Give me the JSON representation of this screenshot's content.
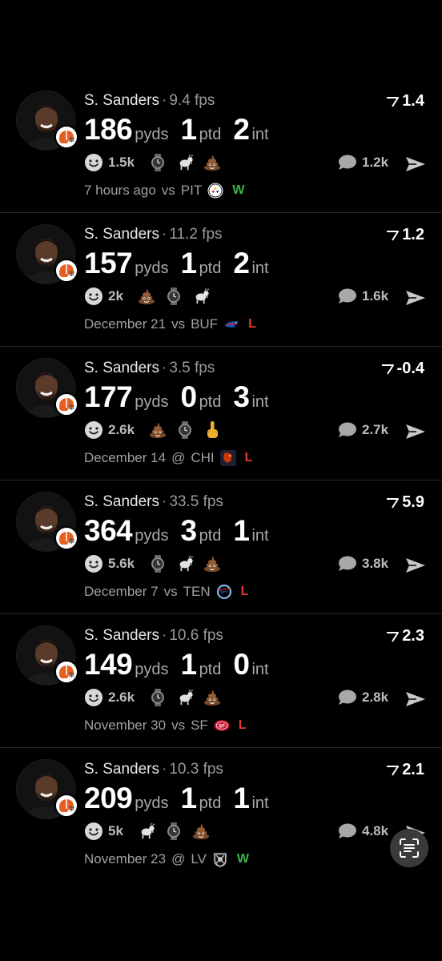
{
  "posts": [
    {
      "name": "S. Sanders",
      "fps": "9.4 fps",
      "vote": "1.4",
      "pyds": "186",
      "pyds_unit": "pyds",
      "ptd": "1",
      "ptd_unit": "ptd",
      "int": "2",
      "int_unit": "int",
      "reaction_count": "1.5k",
      "reactions": [
        "clock-icon",
        "goat-emoji-icon",
        "poop-emoji-icon"
      ],
      "comments": "1.2k",
      "time": "7 hours ago",
      "location": "vs",
      "opponent": "PIT",
      "opponent_logo": "steelers-logo",
      "result": "W"
    },
    {
      "name": "S. Sanders",
      "fps": "11.2 fps",
      "vote": "1.2",
      "pyds": "157",
      "pyds_unit": "pyds",
      "ptd": "1",
      "ptd_unit": "ptd",
      "int": "2",
      "int_unit": "int",
      "reaction_count": "2k",
      "reactions": [
        "poop-emoji-icon",
        "clock-icon",
        "goat-emoji-icon"
      ],
      "comments": "1.6k",
      "time": "December 21",
      "location": "vs",
      "opponent": "BUF",
      "opponent_logo": "bills-logo",
      "result": "L"
    },
    {
      "name": "S. Sanders",
      "fps": "3.5 fps",
      "vote": "-0.4",
      "pyds": "177",
      "pyds_unit": "pyds",
      "ptd": "0",
      "ptd_unit": "ptd",
      "int": "3",
      "int_unit": "int",
      "reaction_count": "2.6k",
      "reactions": [
        "poop-emoji-icon",
        "clock-icon",
        "middle-finger-emoji-icon"
      ],
      "comments": "2.7k",
      "time": "December 14",
      "location": "@",
      "opponent": "CHI",
      "opponent_logo": "bears-logo",
      "result": "L"
    },
    {
      "name": "S. Sanders",
      "fps": "33.5 fps",
      "vote": "5.9",
      "pyds": "364",
      "pyds_unit": "pyds",
      "ptd": "3",
      "ptd_unit": "ptd",
      "int": "1",
      "int_unit": "int",
      "reaction_count": "5.6k",
      "reactions": [
        "clock-icon",
        "goat-emoji-icon",
        "poop-emoji-icon"
      ],
      "comments": "3.8k",
      "time": "December 7",
      "location": "vs",
      "opponent": "TEN",
      "opponent_logo": "titans-logo",
      "result": "L"
    },
    {
      "name": "S. Sanders",
      "fps": "10.6 fps",
      "vote": "2.3",
      "pyds": "149",
      "pyds_unit": "pyds",
      "ptd": "1",
      "ptd_unit": "ptd",
      "int": "0",
      "int_unit": "int",
      "reaction_count": "2.6k",
      "reactions": [
        "clock-icon",
        "goat-emoji-icon",
        "poop-emoji-icon"
      ],
      "comments": "2.8k",
      "time": "November 30",
      "location": "vs",
      "opponent": "SF",
      "opponent_logo": "49ers-logo",
      "result": "L"
    },
    {
      "name": "S. Sanders",
      "fps": "10.3 fps",
      "vote": "2.1",
      "pyds": "209",
      "pyds_unit": "pyds",
      "ptd": "1",
      "ptd_unit": "ptd",
      "int": "1",
      "int_unit": "int",
      "reaction_count": "5k",
      "reactions": [
        "goat-emoji-icon",
        "clock-icon",
        "poop-emoji-icon"
      ],
      "comments": "4.8k",
      "time": "November 23",
      "location": "@",
      "opponent": "LV",
      "opponent_logo": "raiders-logo",
      "result": "W"
    }
  ],
  "colors": {
    "win": "#3ab54a",
    "loss": "#e53935",
    "background": "#000000",
    "muted": "#a0a0a0"
  },
  "overlay": {
    "icon": "text-scan-icon"
  }
}
